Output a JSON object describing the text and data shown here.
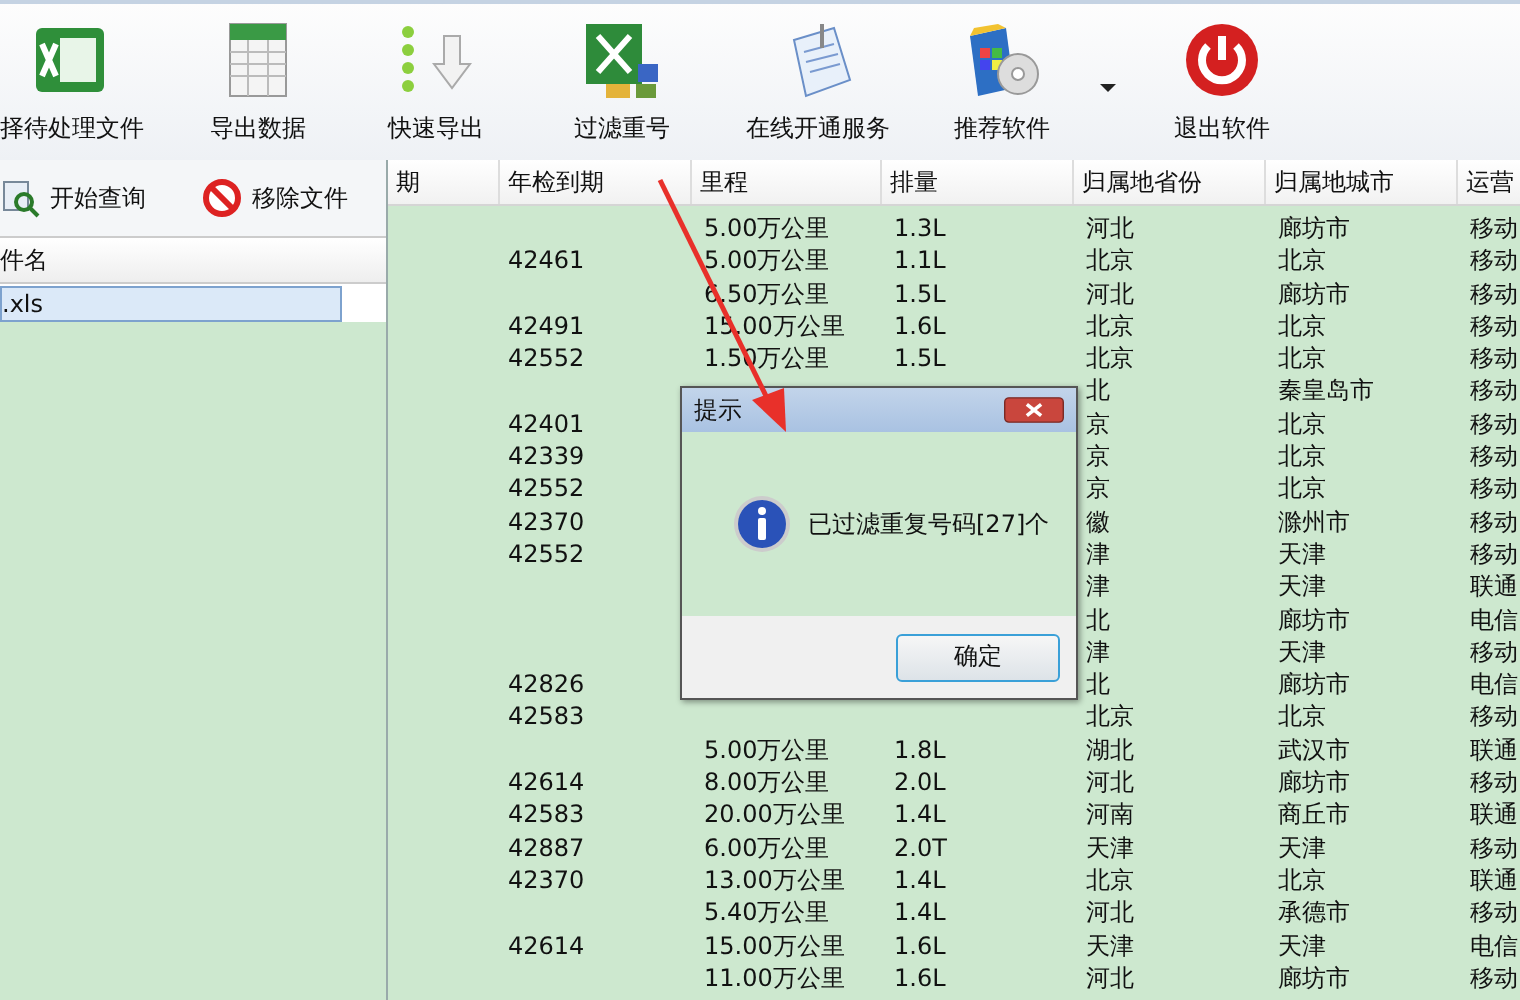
{
  "toolbar": {
    "items": [
      {
        "kind": "excel",
        "label": "择待处理文件"
      },
      {
        "kind": "sheet",
        "label": "导出数据"
      },
      {
        "kind": "export",
        "label": "快速导出"
      },
      {
        "kind": "filter",
        "label": "过滤重号"
      },
      {
        "kind": "service",
        "label": "在线开通服务"
      },
      {
        "kind": "software",
        "label": "推荐软件"
      },
      {
        "kind": "caret"
      },
      {
        "kind": "exit",
        "label": "退出软件"
      }
    ]
  },
  "left_panel": {
    "actions": [
      {
        "kind": "query",
        "label": "开始查询"
      },
      {
        "kind": "remove",
        "label": "移除文件"
      }
    ],
    "file_list": {
      "header": "件名",
      "files": [
        {
          "name": ".xls",
          "selected": true
        }
      ]
    }
  },
  "table": {
    "columns": [
      "期",
      "年检到期",
      "里程",
      "排量",
      "归属地省份",
      "归属地城市",
      "运营"
    ],
    "rows": [
      {
        "mileage": "5.00万公里",
        "displacement": "1.3L",
        "province": "河北",
        "city": "廊坊市",
        "carrier": "移动"
      },
      {
        "inspection": "42461",
        "mileage": "5.00万公里",
        "displacement": "1.1L",
        "province": "北京",
        "city": "北京",
        "carrier": "移动"
      },
      {
        "mileage": "6.50万公里",
        "displacement": "1.5L",
        "province": "河北",
        "city": "廊坊市",
        "carrier": "移动"
      },
      {
        "inspection": "42491",
        "mileage": "15.00万公里",
        "displacement": "1.6L",
        "province": "北京",
        "city": "北京",
        "carrier": "移动"
      },
      {
        "inspection": "42552",
        "mileage": "1.50万公里",
        "displacement": "1.5L",
        "province": "北京",
        "city": "北京",
        "carrier": "移动"
      },
      {
        "province": "北",
        "city": "秦皇岛市",
        "carrier": "移动"
      },
      {
        "inspection": "42401",
        "province": "京",
        "city": "北京",
        "carrier": "移动"
      },
      {
        "inspection": "42339",
        "province": "京",
        "city": "北京",
        "carrier": "移动"
      },
      {
        "inspection": "42552",
        "province": "京",
        "city": "北京",
        "carrier": "移动"
      },
      {
        "inspection": "42370",
        "province": "徽",
        "city": "滁州市",
        "carrier": "移动"
      },
      {
        "inspection": "42552",
        "province": "津",
        "city": "天津",
        "carrier": "移动"
      },
      {
        "province": "津",
        "city": "天津",
        "carrier": "联通"
      },
      {
        "province": "北",
        "city": "廊坊市",
        "carrier": "电信"
      },
      {
        "province": "津",
        "city": "天津",
        "carrier": "移动"
      },
      {
        "inspection": "42826",
        "province": "北",
        "city": "廊坊市",
        "carrier": "电信"
      },
      {
        "inspection": "42583",
        "province": "北京",
        "city": "北京",
        "carrier": "移动"
      },
      {
        "mileage": "5.00万公里",
        "displacement": "1.8L",
        "province": "湖北",
        "city": "武汉市",
        "carrier": "联通"
      },
      {
        "inspection": "42614",
        "mileage": "8.00万公里",
        "displacement": "2.0L",
        "province": "河北",
        "city": "廊坊市",
        "carrier": "移动"
      },
      {
        "inspection": "42583",
        "mileage": "20.00万公里",
        "displacement": "1.4L",
        "province": "河南",
        "city": "商丘市",
        "carrier": "联通"
      },
      {
        "inspection": "42887",
        "mileage": "6.00万公里",
        "displacement": "2.0T",
        "province": "天津",
        "city": "天津",
        "carrier": "移动"
      },
      {
        "inspection": "42370",
        "mileage": "13.00万公里",
        "displacement": "1.4L",
        "province": "北京",
        "city": "北京",
        "carrier": "联通"
      },
      {
        "mileage": "5.40万公里",
        "displacement": "1.4L",
        "province": "河北",
        "city": "承德市",
        "carrier": "移动"
      },
      {
        "inspection": "42614",
        "mileage": "15.00万公里",
        "displacement": "1.6L",
        "province": "天津",
        "city": "天津",
        "carrier": "电信"
      },
      {
        "mileage": "11.00万公里",
        "displacement": "1.6L",
        "province": "河北",
        "city": "廊坊市",
        "carrier": "移动"
      }
    ]
  },
  "dialog": {
    "title": "提示",
    "message": "已过滤重复号码[27]个",
    "ok_button": "确定"
  }
}
